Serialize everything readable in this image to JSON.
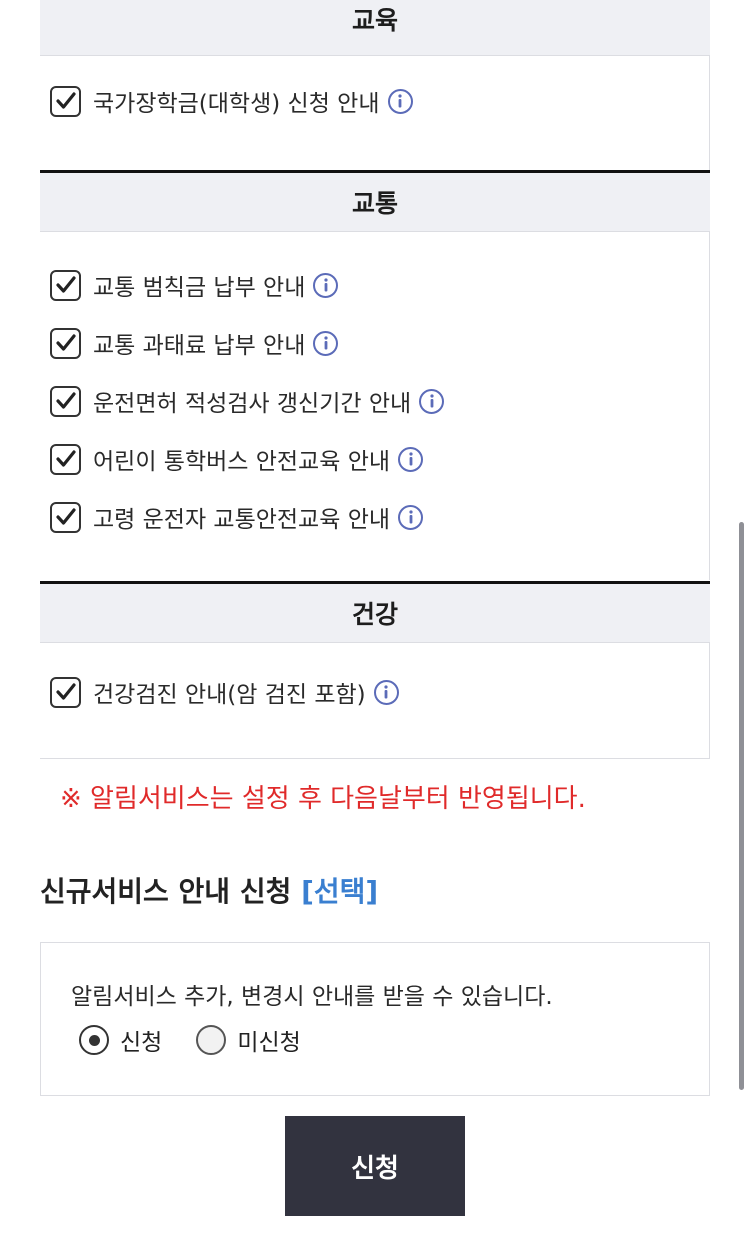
{
  "sections": [
    {
      "title": "교육",
      "items": [
        "국가장학금(대학생) 신청 안내"
      ]
    },
    {
      "title": "교통",
      "items": [
        "교통 범칙금 납부 안내",
        "교통 과태료 납부 안내",
        "운전면허 적성검사 갱신기간 안내",
        "어린이 통학버스 안전교육 안내",
        "고령 운전자 교통안전교육 안내"
      ]
    },
    {
      "title": "건강",
      "items": [
        "건강검진 안내(암 검진 포함)"
      ]
    }
  ],
  "notice": "※ 알림서비스는 설정 후 다음날부터 반영됩니다.",
  "new_service": {
    "title": "신규서비스 안내 신청",
    "tag": "[선택]",
    "description": "알림서비스 추가, 변경시 안내를 받을 수 있습니다.",
    "options": [
      "신청",
      "미신청"
    ],
    "selected": "신청"
  },
  "submit_label": "신청",
  "colors": {
    "notice": "#e02a2a",
    "tag": "#3a7fd0",
    "button": "#32333f",
    "info_icon": "#5b6bb8"
  },
  "icons": {
    "checkbox": "checked-checkbox-icon",
    "info": "info-icon"
  }
}
